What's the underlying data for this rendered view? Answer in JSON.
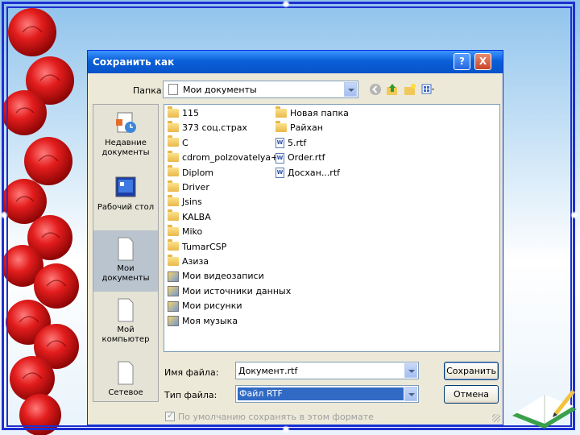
{
  "dialog": {
    "title": "Сохранить как",
    "help_glyph": "?",
    "close_glyph": "X"
  },
  "lookin": {
    "label": "Папка:",
    "value": "Мои документы"
  },
  "places": [
    {
      "label": "Недавние документы"
    },
    {
      "label": "Рабочий стол"
    },
    {
      "label": "Мои документы"
    },
    {
      "label": "Мой компьютер"
    },
    {
      "label": "Сетевое"
    }
  ],
  "files_col1": [
    {
      "name": "115",
      "type": "folder"
    },
    {
      "name": "373 соц.страх",
      "type": "folder"
    },
    {
      "name": "C",
      "type": "folder"
    },
    {
      "name": "cdrom_polzovatelya+2",
      "type": "folder"
    },
    {
      "name": "Diplom",
      "type": "folder"
    },
    {
      "name": "Driver",
      "type": "folder"
    },
    {
      "name": "Jsins",
      "type": "folder"
    },
    {
      "name": "KALBA",
      "type": "folder"
    },
    {
      "name": "Miko",
      "type": "folder"
    },
    {
      "name": "TumarCSP",
      "type": "folder"
    },
    {
      "name": "Азиза",
      "type": "folder"
    },
    {
      "name": "Мои видеозаписи",
      "type": "special"
    },
    {
      "name": "Мои источники данных",
      "type": "special"
    },
    {
      "name": "Мои рисунки",
      "type": "special"
    },
    {
      "name": "Моя музыка",
      "type": "special"
    }
  ],
  "files_col2": [
    {
      "name": "Новая папка",
      "type": "folder"
    },
    {
      "name": "Райхан",
      "type": "folder"
    },
    {
      "name": "5.rtf",
      "type": "rtf"
    },
    {
      "name": "Order.rtf",
      "type": "rtf"
    },
    {
      "name": "Досхан...rtf",
      "type": "rtf"
    }
  ],
  "filename": {
    "label": "Имя файла:",
    "value": "Документ.rtf"
  },
  "filetype": {
    "label": "Тип файла:",
    "value": "Файл RTF"
  },
  "buttons": {
    "save": "Сохранить",
    "cancel": "Отмена"
  },
  "checkbox": {
    "label": "По умолчанию сохранять в этом формате",
    "checked": true
  }
}
